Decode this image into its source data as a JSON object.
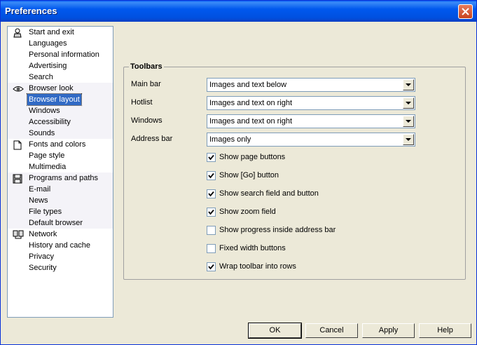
{
  "window": {
    "title": "Preferences"
  },
  "sidebar": {
    "groups": [
      {
        "icon": "person-icon",
        "items": [
          "Start and exit",
          "Languages",
          "Personal information",
          "Advertising",
          "Search"
        ]
      },
      {
        "icon": "eye-icon",
        "items": [
          "Browser look",
          "Browser layout",
          "Windows",
          "Accessibility",
          "Sounds"
        ]
      },
      {
        "icon": "page-icon",
        "items": [
          "Fonts and colors",
          "Page style",
          "Multimedia"
        ]
      },
      {
        "icon": "floppy-disk-icon",
        "items": [
          "Programs and paths",
          "E-mail",
          "News",
          "File types",
          "Default browser"
        ]
      },
      {
        "icon": "network-icon",
        "items": [
          "Network",
          "History and cache",
          "Privacy",
          "Security"
        ]
      }
    ],
    "selected": "Browser layout"
  },
  "toolbars": {
    "legend": "Toolbars",
    "rows": [
      {
        "label": "Main bar",
        "value": "Images and text below"
      },
      {
        "label": "Hotlist",
        "value": "Images and text on right"
      },
      {
        "label": "Windows",
        "value": "Images and text on right"
      },
      {
        "label": "Address bar",
        "value": "Images only"
      }
    ],
    "checkboxes": [
      {
        "label": "Show page buttons",
        "checked": true
      },
      {
        "label": "Show [Go] button",
        "checked": true
      },
      {
        "label": "Show search field and button",
        "checked": true
      },
      {
        "label": "Show zoom field",
        "checked": true
      },
      {
        "label": "Show progress inside address bar",
        "checked": false
      },
      {
        "label": "Fixed width buttons",
        "checked": false
      },
      {
        "label": "Wrap toolbar into rows",
        "checked": true
      }
    ]
  },
  "buttons": {
    "ok": "OK",
    "cancel": "Cancel",
    "apply": "Apply",
    "help": "Help"
  }
}
